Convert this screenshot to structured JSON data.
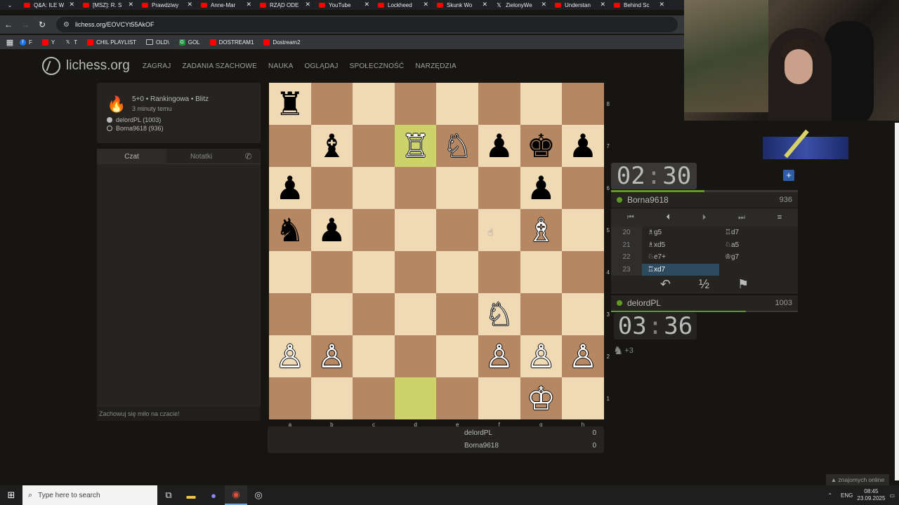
{
  "browser": {
    "tabs": [
      {
        "label": "Q&A: ILE W",
        "fav": "yt"
      },
      {
        "label": "[MSZ]: R. S",
        "fav": "yt"
      },
      {
        "label": "Prawdziwy",
        "fav": "yt"
      },
      {
        "label": "Anne-Mar",
        "fav": "yt"
      },
      {
        "label": "RZĄD ODE",
        "fav": "yt"
      },
      {
        "label": "YouTube",
        "fav": "yt"
      },
      {
        "label": "Lockheed",
        "fav": "yt"
      },
      {
        "label": "Skunk Wo",
        "fav": "yt"
      },
      {
        "label": "ZielonyWe",
        "fav": "x"
      },
      {
        "label": "Understan",
        "fav": "yt"
      },
      {
        "label": "Behind Sc",
        "fav": "yt"
      }
    ],
    "url": "lichess.org/EOVCYt55AkOF",
    "bookmarks": [
      {
        "label": "F",
        "icon": "fb"
      },
      {
        "label": "Y",
        "icon": "yt"
      },
      {
        "label": "T",
        "icon": "tw"
      },
      {
        "label": "CHIL PLAYLIST",
        "icon": "yt"
      },
      {
        "label": "OLD\\",
        "icon": "fo"
      },
      {
        "label": "GOL",
        "icon": "gr"
      },
      {
        "label": "DOSTREAM1",
        "icon": "yt"
      },
      {
        "label": "Dostream2",
        "icon": "yt"
      }
    ]
  },
  "header": {
    "logo": "lichess",
    "logo_suffix": ".org",
    "nav": [
      "ZAGRAJ",
      "ZADANIA SZACHOWE",
      "NAUKA",
      "OGLĄDAJ",
      "SPOŁECZNOŚĆ",
      "NARZĘDZIA"
    ]
  },
  "game_info": {
    "type": "5+0 • Rankingowa • Blitz",
    "time": "3 minuty temu",
    "white": "delordPL (1003)",
    "black": "Borna9618 (936)"
  },
  "chat": {
    "tab_chat": "Czat",
    "tab_notes": "Notatki",
    "footer": "Zachowuj się miło na czacie!"
  },
  "board": {
    "rank_labels": [
      "8",
      "7",
      "6",
      "5",
      "4",
      "3",
      "2",
      "1"
    ],
    "file_labels": [
      "a",
      "b",
      "c",
      "d",
      "e",
      "f",
      "g",
      "h"
    ],
    "highlight": [
      "d7",
      "d1"
    ],
    "pieces": [
      {
        "sq": "a8",
        "p": "♜",
        "c": "b"
      },
      {
        "sq": "b7",
        "p": "♝",
        "c": "b"
      },
      {
        "sq": "d7",
        "p": "♖",
        "c": "w"
      },
      {
        "sq": "e7",
        "p": "♘",
        "c": "w"
      },
      {
        "sq": "f7",
        "p": "♟",
        "c": "b"
      },
      {
        "sq": "g7",
        "p": "♚",
        "c": "b"
      },
      {
        "sq": "h7",
        "p": "♟",
        "c": "b"
      },
      {
        "sq": "a6",
        "p": "♟",
        "c": "b"
      },
      {
        "sq": "g6",
        "p": "♟",
        "c": "b"
      },
      {
        "sq": "a5",
        "p": "♞",
        "c": "b"
      },
      {
        "sq": "b5",
        "p": "♟",
        "c": "b"
      },
      {
        "sq": "g5",
        "p": "♗",
        "c": "w"
      },
      {
        "sq": "f3",
        "p": "♘",
        "c": "w"
      },
      {
        "sq": "a2",
        "p": "♙",
        "c": "w"
      },
      {
        "sq": "b2",
        "p": "♙",
        "c": "w"
      },
      {
        "sq": "f2",
        "p": "♙",
        "c": "w"
      },
      {
        "sq": "g2",
        "p": "♙",
        "c": "w"
      },
      {
        "sq": "h2",
        "p": "♙",
        "c": "w"
      },
      {
        "sq": "g1",
        "p": "♔",
        "c": "w"
      }
    ]
  },
  "score": {
    "white_name": "delordPL",
    "white_score": "0",
    "black_name": "Borna9618",
    "black_score": "0"
  },
  "clocks": {
    "top": {
      "min": "02",
      "sec": "30"
    },
    "bottom": {
      "min": "03",
      "sec": "36"
    },
    "top_remaining_fraction": 0.5,
    "bottom_remaining_fraction": 0.72
  },
  "players": {
    "top": {
      "name": "Borna9618",
      "rating": "936"
    },
    "bottom": {
      "name": "delordPL",
      "rating": "1003"
    }
  },
  "moves": [
    {
      "n": "20",
      "w": "♗g5",
      "b": "♖d7"
    },
    {
      "n": "21",
      "w": "♗xd5",
      "b": "♘a5"
    },
    {
      "n": "22",
      "w": "♘e7+",
      "b": "♔g7"
    },
    {
      "n": "23",
      "w": "♖xd7",
      "b": ""
    }
  ],
  "controls": {
    "first": "⏮",
    "prev": "⏴",
    "next": "⏵",
    "last": "⏭",
    "menu": "≡",
    "takeback": "↶",
    "draw": "½",
    "resign": "⚑"
  },
  "extra": {
    "horse_plus": "+3",
    "friends_online": "▲ znajomych online"
  },
  "taskbar": {
    "search_placeholder": "Type here to search",
    "lang": "ENG",
    "time": "08:45",
    "date": "23.09.2025"
  }
}
